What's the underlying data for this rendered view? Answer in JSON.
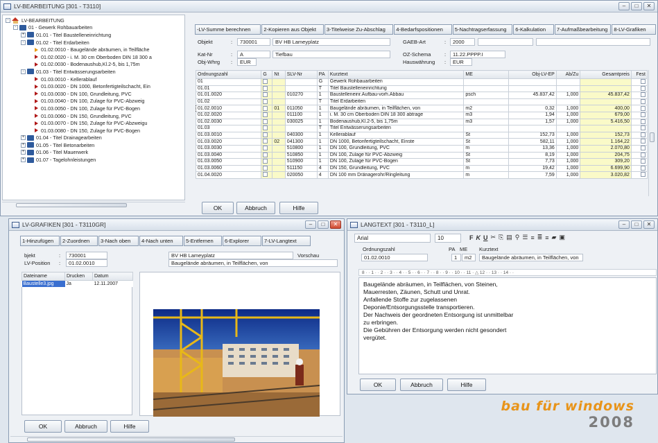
{
  "win1": {
    "title": "LV-BEARBEITUNG [301 - T3110]"
  },
  "tree": [
    {
      "label": "LV-BEARBEITUNG",
      "lvl": 0,
      "icon": "house",
      "tog": "-"
    },
    {
      "label": "01 - Gewerk Rohbauarbeiten",
      "lvl": 1,
      "icon": "folder",
      "tog": "-"
    },
    {
      "label": "01.01 - Titel Baustelleneinrichtung",
      "lvl": 2,
      "icon": "folder",
      "tog": "+"
    },
    {
      "label": "01.02 - Titel Erdarbeiten",
      "lvl": 2,
      "icon": "folder",
      "tog": "-"
    },
    {
      "label": "01.02.0010 - Baugelände abräumen, in Teilfläche",
      "lvl": 3,
      "icon": "tri-o"
    },
    {
      "label": "01.02.0020 - i. M. 30 cm Oberboden DIN 18 300 a",
      "lvl": 3,
      "icon": "tri"
    },
    {
      "label": "01.02.0030 - Bodenaushub,Kl.2-5, bis 1,75m",
      "lvl": 3,
      "icon": "tri"
    },
    {
      "label": "01.03 - Titel Entwässerungsarbeiten",
      "lvl": 2,
      "icon": "folder",
      "tog": "-"
    },
    {
      "label": "01.03.0010 - Kellerablauf",
      "lvl": 3,
      "icon": "tri"
    },
    {
      "label": "01.03.0020 - DN 1000, Betonfertigteilschacht, Ein",
      "lvl": 3,
      "icon": "tri"
    },
    {
      "label": "01.03.0030 - DN 100, Grundleitung, PVC",
      "lvl": 3,
      "icon": "tri"
    },
    {
      "label": "01.03.0040 - DN 100, Zulage für PVC-Abzweig",
      "lvl": 3,
      "icon": "tri"
    },
    {
      "label": "01.03.0050 - DN 100, Zulage für PVC-Bogen",
      "lvl": 3,
      "icon": "tri"
    },
    {
      "label": "01.03.0060 - DN 150, Grundleitung, PVC",
      "lvl": 3,
      "icon": "tri"
    },
    {
      "label": "01.03.0070 - DN 150, Zulage für PVC-Abzweigu",
      "lvl": 3,
      "icon": "tri"
    },
    {
      "label": "01.03.0080 - DN 150, Zulage für PVC-Bogen",
      "lvl": 3,
      "icon": "tri"
    },
    {
      "label": "01.04 - Titel Drainagearbeiten",
      "lvl": 2,
      "icon": "folder",
      "tog": "+"
    },
    {
      "label": "01.05 - Titel Betonarbeiten",
      "lvl": 2,
      "icon": "folder",
      "tog": "+"
    },
    {
      "label": "01.06 - Titel Mauerwerk",
      "lvl": 2,
      "icon": "folder",
      "tog": "+"
    },
    {
      "label": "01.07 - Tagelohnleistungen",
      "lvl": 2,
      "icon": "folder",
      "tog": "+"
    }
  ],
  "tabs1": [
    "-LV-Summe berechnen",
    "2-Kopieren aus Objekt",
    "3-Titelweise Zu-Abschlag",
    "4-Bedarfspositionen",
    "5-Nachtragserfassung",
    "6-Kalkulation",
    "7-Aufmaßbearbeitung",
    "8-LV-Grafiken"
  ],
  "hdr": {
    "objekt_lbl": "Objekt",
    "objekt_nr": "730001",
    "objekt_name": "BV HB Lameyplatz",
    "gaeb_lbl": "GAEB-Art",
    "gaeb_val": "2000",
    "katnr_lbl": "Kat-Nr",
    "katnr_val": "A",
    "kat_name": "Tiefbau",
    "oz_lbl": "OZ-Schema",
    "oz_val": "11.22.PPPP.I",
    "objwhrg_lbl": "Obj-Whrg",
    "objwhrg_val": "EUR",
    "hw_lbl": "Hauswährung",
    "hw_val": "EUR"
  },
  "grid": {
    "cols": [
      "Ordnungszahl",
      "G",
      "Nt",
      "SLV-Nr",
      "PA",
      "Kurztext",
      "ME",
      "Obj-LV-EP",
      "Ab/Zu",
      "Gesamtpreis",
      "Fest"
    ],
    "rows": [
      [
        "01",
        "",
        "",
        "",
        "G",
        "Gewerk Rohbauarbeiten",
        "",
        "",
        "",
        "",
        ""
      ],
      [
        "01.01",
        "",
        "",
        "",
        "T",
        "Titel Baustelleneinrichtung",
        "",
        "",
        "",
        "",
        ""
      ],
      [
        "01.01.0020",
        "",
        "",
        "010270",
        "1",
        "Baustelleneinr.Aufbau-vorh.Abbau",
        "psch",
        "45.837,42",
        "1,000",
        "45.837,42",
        ""
      ],
      [
        "01.02",
        "",
        "",
        "",
        "T",
        "Titel Erdarbeiten",
        "",
        "",
        "",
        "",
        ""
      ],
      [
        "01.02.0010",
        "",
        "01",
        "011050",
        "1",
        "Baugelände abräumen, in Teilflächen, von",
        "m2",
        "0,32",
        "1,000",
        "400,00",
        ""
      ],
      [
        "01.02.0020",
        "",
        "",
        "011100",
        "1",
        "i. M. 30 cm Oberboden DIN 18 300 abtrage",
        "m3",
        "1,94",
        "1,000",
        "679,00",
        ""
      ],
      [
        "01.02.0030",
        "",
        "",
        "030025",
        "1",
        "Bodenaushub,Kl.2-5, bis 1,75m",
        "m3",
        "1,57",
        "1,000",
        "5.416,50",
        ""
      ],
      [
        "01.03",
        "",
        "",
        "",
        "T",
        "Titel Entwässerungsarbeiten",
        "",
        "",
        "",
        "",
        ""
      ],
      [
        "01.03.0010",
        "",
        "",
        "040300",
        "1",
        "Kellerablauf",
        "St",
        "152,73",
        "1,000",
        "152,73",
        ""
      ],
      [
        "01.03.0020",
        "",
        "02",
        "041300",
        "1",
        "DN 1000, Betonfertigteilschacht, Einste",
        "St",
        "582,11",
        "1,000",
        "1.164,22",
        ""
      ],
      [
        "01.03.0030",
        "",
        "",
        "510800",
        "1",
        "DN 100, Grundleitung, PVC",
        "m",
        "13,36",
        "1,000",
        "2.070,80",
        ""
      ],
      [
        "01.03.0040",
        "",
        "",
        "510850",
        "1",
        "DN 100, Zulage für PVC-Abzweig",
        "St",
        "8,19",
        "1,000",
        "204,75",
        ""
      ],
      [
        "01.03.0050",
        "",
        "",
        "510900",
        "1",
        "DN 100, Zulage für PVC-Bogen",
        "St",
        "7,73",
        "1,000",
        "309,20",
        ""
      ],
      [
        "01.03.0060",
        "",
        "",
        "511150",
        "4",
        "DN 150, Grundleitung, PVC",
        "m",
        "19,42",
        "1,000",
        "6.699,90",
        ""
      ],
      [
        "01.04.0020",
        "",
        "",
        "020050",
        "4",
        "DN 100 mm Dränagerohr/Ringleitung",
        "m",
        "7,59",
        "1,000",
        "3.020,82",
        ""
      ]
    ]
  },
  "buttons1": {
    "ok": "OK",
    "abbruch": "Abbruch",
    "hilfe": "Hilfe"
  },
  "win2": {
    "title": "LV-GRAFIKEN [301 - T3110GR]",
    "tabs": [
      "1-Hinzufügen",
      "2-Zuordnen",
      "3-Nach oben",
      "4-Nach unten",
      "5-Entfernen",
      "6-Explorer",
      "7-LV-Langtext"
    ],
    "objekt_lbl": "bjekt",
    "objekt_nr": "730001",
    "objekt_name": "BV HB Lameyplatz",
    "vorschau": "Vorschau",
    "lvpos_lbl": "LV-Position",
    "lvpos_val": "01.02.0010",
    "lvpos_text": "Baugelände abräumen, in Teilflächen, von",
    "file_cols": [
      "Dateiname",
      "Drucken",
      "Datum"
    ],
    "file_rows": [
      [
        "Baustelle3.jpg",
        "Ja",
        "12.11.2007"
      ]
    ],
    "ok": "OK",
    "abbruch": "Abbruch",
    "hilfe": "Hilfe"
  },
  "win3": {
    "title": "LANGTEXT [301 - T3110_L]",
    "font": "Arial",
    "size": "10",
    "oz_lbl": "Ordnungszahl",
    "pa_lbl": "PA",
    "me_lbl": "ME",
    "kt_lbl": "Kurztext",
    "oz_val": "01.02.0010",
    "pa_val": "1",
    "me_val": "m2",
    "kt_val": "Baugelände abräumen, in Teilflächen, von",
    "ruler": "8 · · 1 · · 2 · · 3 · · 4 · · 5 · · 6 · · 7 · · 8 · · 9 · · 10 · · 11 · △ 12 · · 13 · · 14 · ·",
    "lines": [
      "Baugelände abräumen, in Teilflächen, von Steinen,",
      "Mauerresten, Zäunen, Schutt und Unrat.",
      "Anfallende Stoffe zur zugelassenen",
      "Deponie/Entsorgungsstelle transportieren.",
      "Der Nachweis der geordneten Entsorgung ist unmittelbar",
      "zu erbringen.",
      "Die Gebühren der Entsorgung werden nicht gesondert",
      "vergütet."
    ],
    "ok": "OK",
    "abbruch": "Abbruch",
    "hilfe": "Hilfe"
  },
  "logo": {
    "line1": "bau für windows",
    "line2": "2008",
    "c1": "#e8941a",
    "c2": "#7d7d7d"
  }
}
